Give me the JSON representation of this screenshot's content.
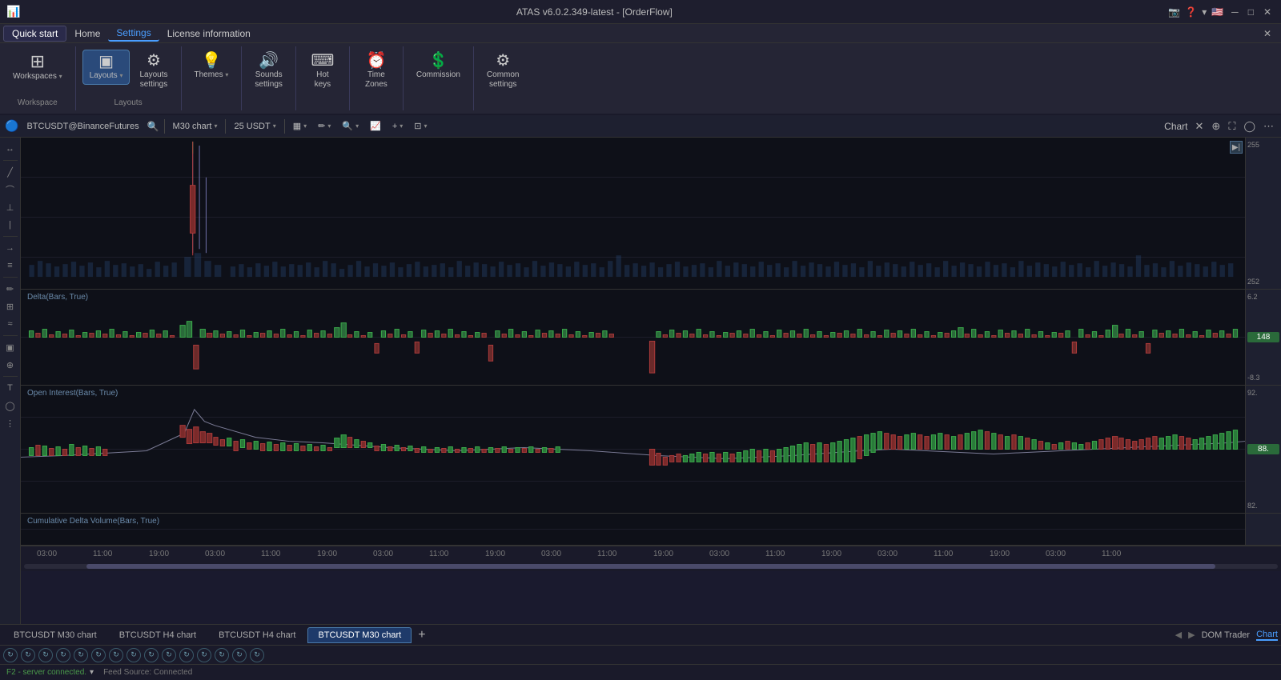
{
  "app": {
    "title": "ATAS v6.0.2.349-latest - [OrderFlow]",
    "icon": "📊"
  },
  "titlebar": {
    "screenshot_icon": "📷",
    "help_icon": "❓",
    "dropdown_arrow": "▾",
    "flag_icon": "🇺🇸",
    "minimize": "─",
    "restore": "□",
    "close": "✕"
  },
  "menubar": {
    "items": [
      {
        "label": "Quick start",
        "active": true
      },
      {
        "label": "Home",
        "active": false
      },
      {
        "label": "Settings",
        "active": true
      },
      {
        "label": "License information",
        "active": false
      }
    ],
    "close": "✕"
  },
  "ribbon": {
    "workspaces_section": {
      "label": "Workspace",
      "items": [
        {
          "icon": "⊞",
          "label": "Workspaces",
          "has_arrow": true
        }
      ]
    },
    "layouts_section": {
      "label": "Layouts",
      "items": [
        {
          "icon": "▣",
          "label": "Layouts",
          "has_arrow": true,
          "active": true
        },
        {
          "icon": "⚙",
          "label": "Layouts settings"
        }
      ]
    },
    "themes_section": {
      "label": "",
      "items": [
        {
          "icon": "💡",
          "label": "Themes",
          "has_arrow": true
        }
      ]
    },
    "sounds_section": {
      "label": "",
      "items": [
        {
          "icon": "🔊",
          "label": "Sounds settings"
        }
      ]
    },
    "hotkeys_section": {
      "label": "",
      "items": [
        {
          "icon": "⌨",
          "label": "Hot keys"
        }
      ]
    },
    "timezones_section": {
      "label": "",
      "items": [
        {
          "icon": "⏰",
          "label": "Time Zones"
        }
      ]
    },
    "commission_section": {
      "label": "",
      "items": [
        {
          "icon": "💲",
          "label": "Commission"
        }
      ]
    },
    "common_section": {
      "label": "",
      "items": [
        {
          "icon": "⚙",
          "label": "Common settings"
        }
      ]
    }
  },
  "chart_toolbar": {
    "symbol": "BTCUSDT@BinanceFutures",
    "timeframe": "M30 chart",
    "quantity": "25 USDT",
    "chart_type_icon": "▦",
    "pen_icon": "✏",
    "zoom_icon": "🔍",
    "chart_mode_icon": "📈",
    "add_icon": "+",
    "layout_icon": "⊡",
    "title": "Chart",
    "icons": [
      "✕",
      "⊕",
      "⛶",
      "◯",
      "⋯"
    ]
  },
  "left_tools": [
    "↔",
    "╱",
    "⌒",
    "⊥",
    "|",
    "→",
    "≡",
    "✏",
    "⊞",
    "≈",
    "▣",
    "⊕",
    "T",
    "◯",
    "⋮"
  ],
  "chart_panels": {
    "main": {
      "price_high": "255",
      "price_low": "252",
      "nav_btn": "▶|"
    },
    "delta": {
      "label": "Delta(Bars, True)",
      "price_high": "6.2",
      "price_low": "8.3",
      "badge": "148"
    },
    "oi": {
      "label": "Open Interest(Bars, True)",
      "price_high": "92.",
      "price_low": "82.",
      "badge": "88."
    },
    "cumulative": {
      "label": "Cumulative Delta Volume(Bars, True)"
    }
  },
  "time_axis": {
    "labels": [
      "03:00",
      "11:00",
      "19:00",
      "03:00",
      "11:00",
      "19:00",
      "03:00",
      "11:00",
      "19:00",
      "03:00",
      "11:00",
      "19:00",
      "03:00",
      "11:00",
      "19:00",
      "03:00",
      "11:00",
      "19:00",
      "03:00",
      "11:00"
    ]
  },
  "tabs": {
    "items": [
      {
        "label": "BTCUSDT M30 chart",
        "active": false
      },
      {
        "label": "BTCUSDT H4 chart",
        "active": false
      },
      {
        "label": "BTCUSDT H4 chart",
        "active": false
      },
      {
        "label": "BTCUSDT M30 chart",
        "active": true
      }
    ],
    "add": "+",
    "right": [
      "DOM Trader",
      "Chart"
    ]
  },
  "icon_bar": {
    "count": 15,
    "icon": "↻"
  },
  "status_bar": {
    "server": "F2 - server connected.",
    "arrow": "▾",
    "feed": "Feed Source: Connected"
  }
}
